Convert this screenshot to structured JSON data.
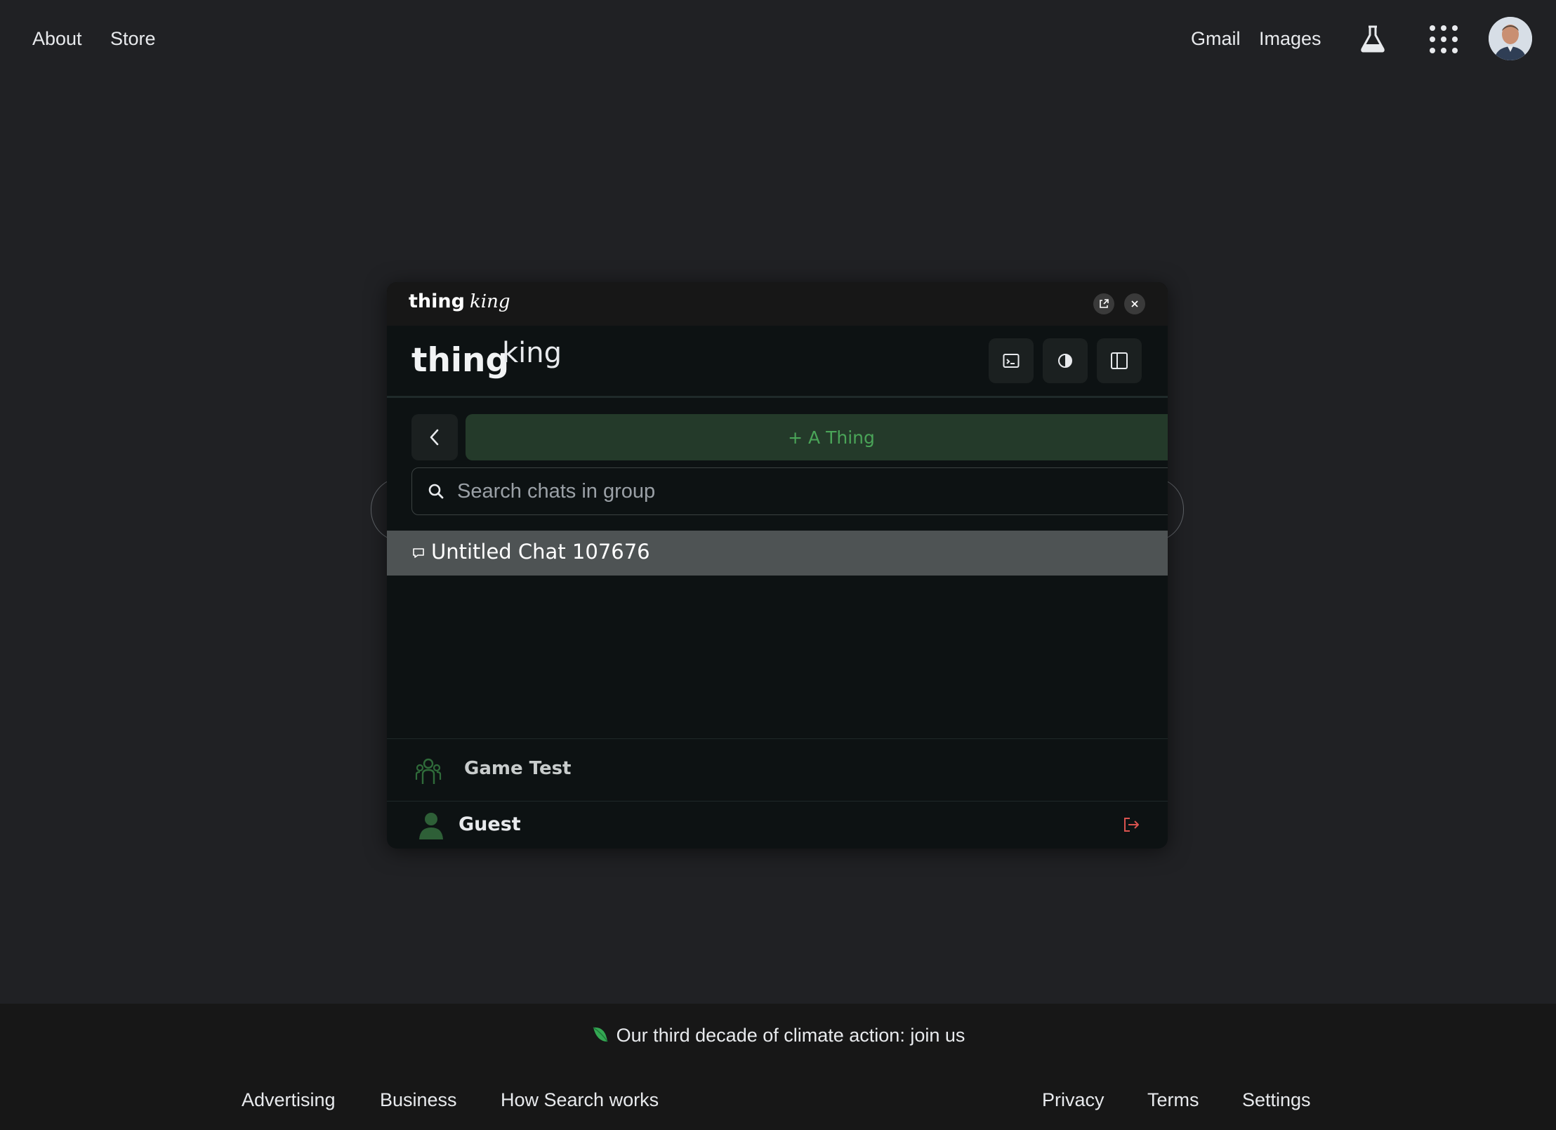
{
  "topbar": {
    "about": "About",
    "store": "Store",
    "gmail": "Gmail",
    "images": "Images",
    "labs_icon": "flask-icon",
    "apps_icon": "apps-grid-icon"
  },
  "widget": {
    "title_bold": "thing",
    "title_italic": "king",
    "logo_bold": "thing",
    "logo_light": "king",
    "new_thing_label": "+ A Thing",
    "search_placeholder": "Search chats in group",
    "chats": [
      {
        "label": "Untitled Chat 107676"
      }
    ],
    "group_name": "Game Test",
    "user_name": "Guest",
    "colors": {
      "accent_green": "#4aa458",
      "button_green_bg": "#243a2a",
      "selected_row": "#4e5354",
      "logout_red": "#d9534f"
    }
  },
  "footer": {
    "climate": "Our third decade of climate action: join us",
    "links_left": [
      "Advertising",
      "Business",
      "How Search works"
    ],
    "links_right": [
      "Privacy",
      "Terms",
      "Settings"
    ]
  }
}
